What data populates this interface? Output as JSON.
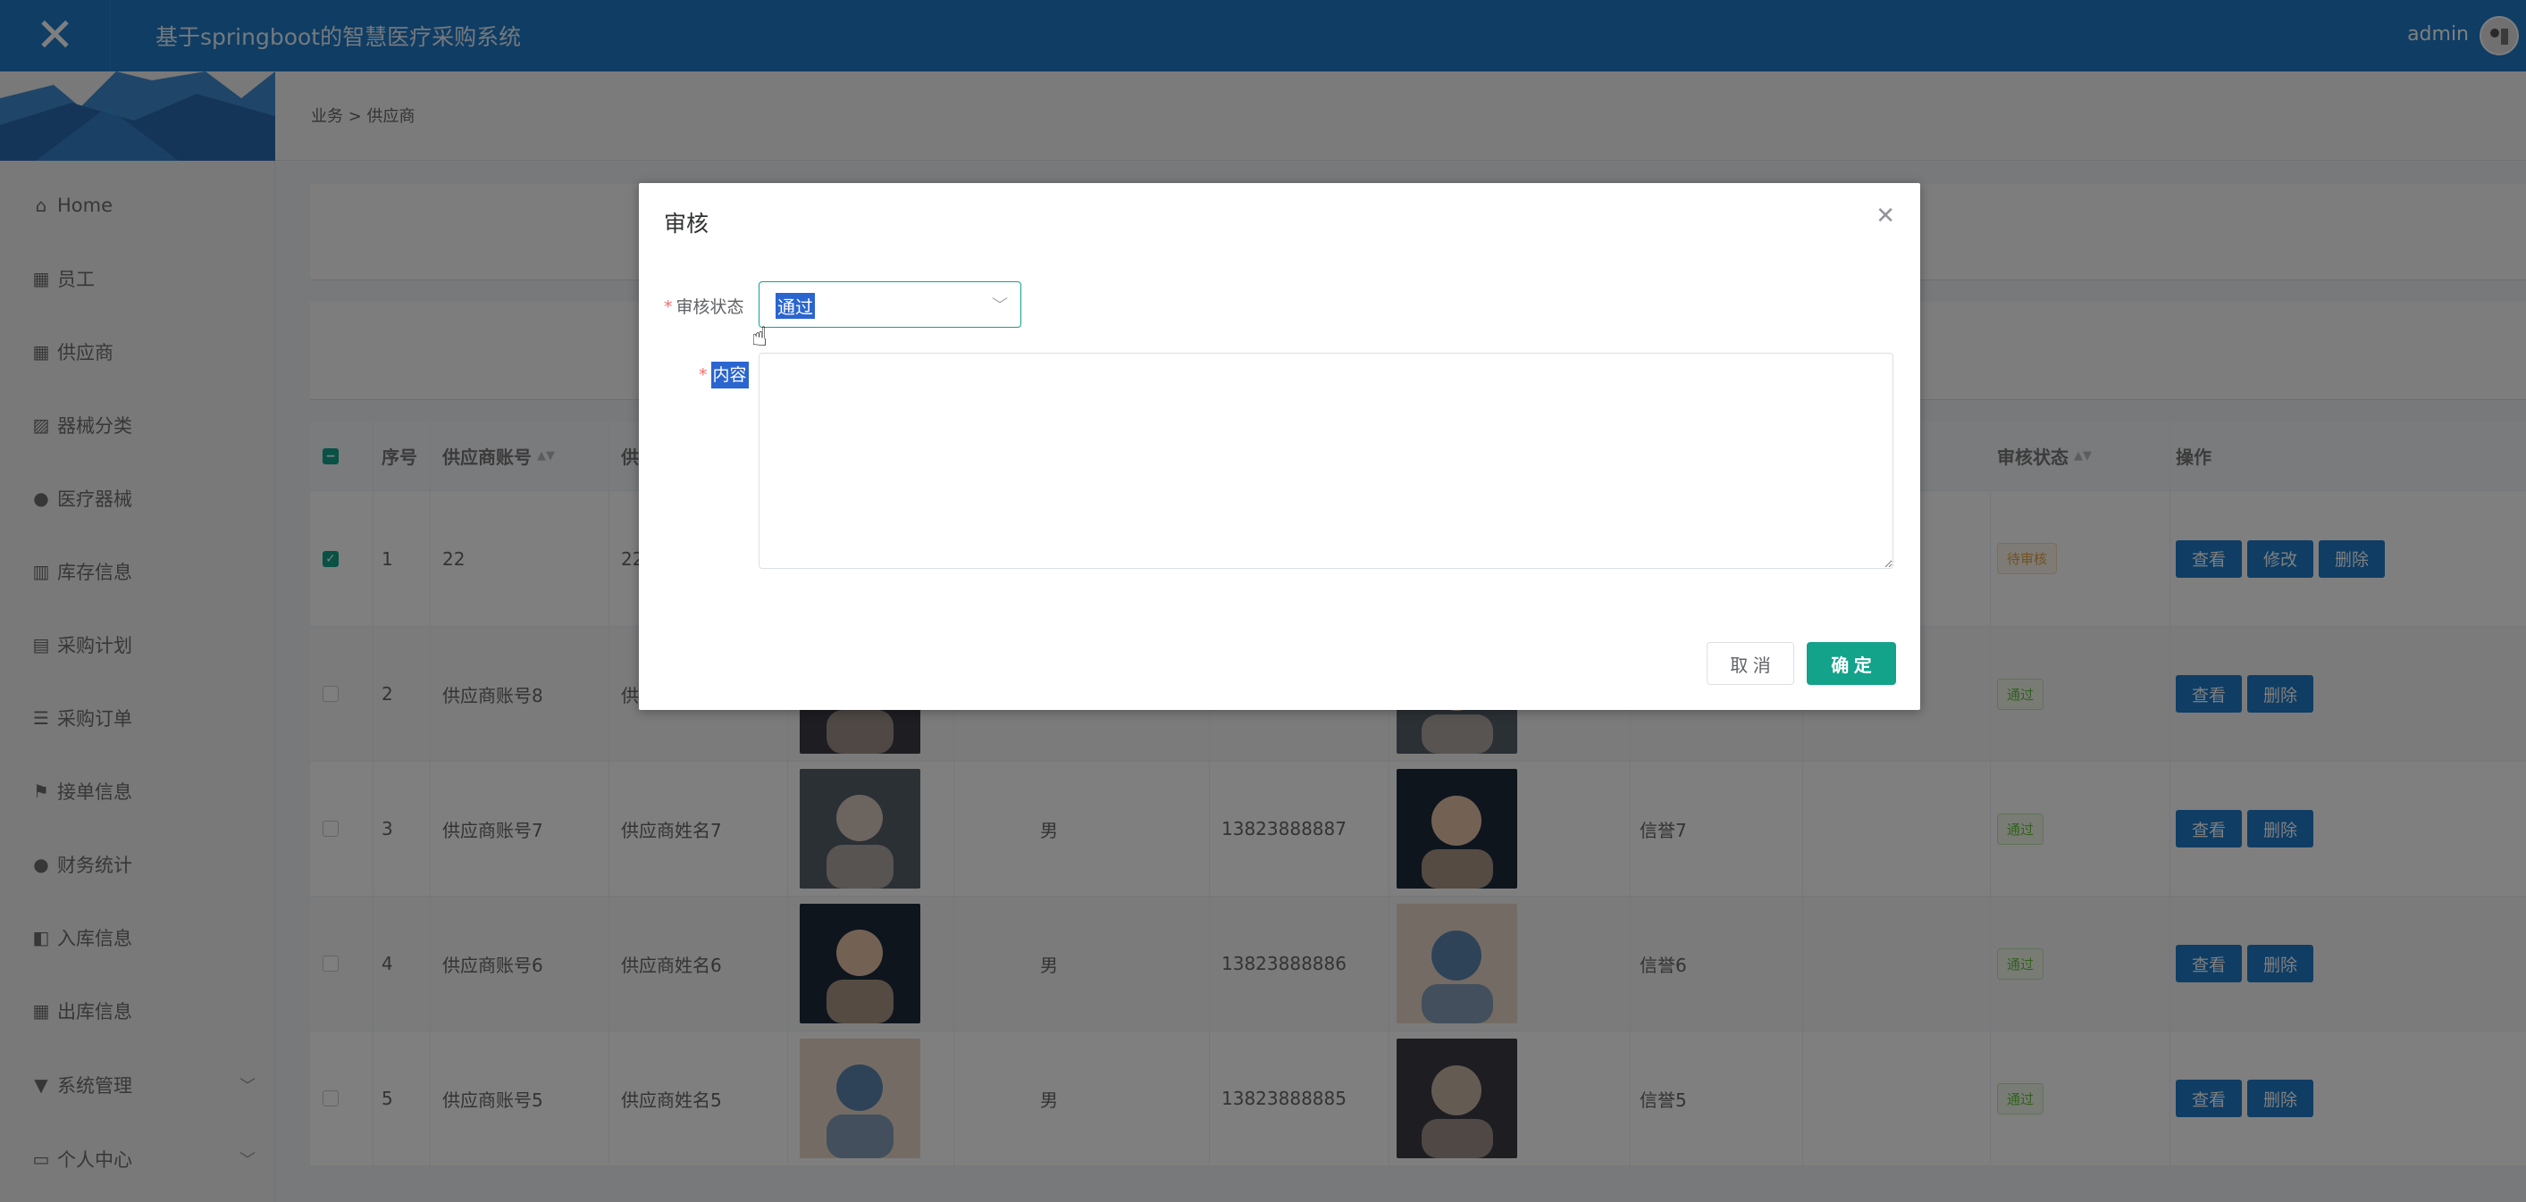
{
  "header": {
    "title": "基于springboot的智慧医疗采购系统",
    "user": "admin",
    "close_glyph": "✕"
  },
  "sidebar": {
    "items": [
      {
        "label": "Home",
        "icon": "home-icon"
      },
      {
        "label": "员工",
        "icon": "grid-icon"
      },
      {
        "label": "供应商",
        "icon": "grid-icon"
      },
      {
        "label": "器械分类",
        "icon": "chart-icon"
      },
      {
        "label": "医疗器械",
        "icon": "user-icon"
      },
      {
        "label": "库存信息",
        "icon": "library-icon"
      },
      {
        "label": "采购计划",
        "icon": "clipboard-icon"
      },
      {
        "label": "采购订单",
        "icon": "list-icon"
      },
      {
        "label": "接单信息",
        "icon": "flag-icon"
      },
      {
        "label": "财务统计",
        "icon": "user-icon"
      },
      {
        "label": "入库信息",
        "icon": "ticket-icon"
      },
      {
        "label": "出库信息",
        "icon": "grid-icon"
      },
      {
        "label": "系统管理",
        "icon": "settings-icon"
      },
      {
        "label": "个人中心",
        "icon": "window-icon"
      }
    ]
  },
  "breadcrumb": "业务 > 供应商",
  "table": {
    "headers": {
      "index": "序号",
      "account": "供应商账号",
      "name_partial": "供",
      "status": "审核状态",
      "actions": "操作"
    },
    "rows": [
      {
        "index": "1",
        "account": "22",
        "name": "22",
        "gender": "",
        "phone": "",
        "credit": "",
        "status": "待审核",
        "status_color": "#e6a23c",
        "buttons": [
          "查看",
          "修改",
          "删除"
        ],
        "checked": true,
        "photos": false
      },
      {
        "index": "2",
        "account": "供应商账号8",
        "name": "供",
        "gender": "",
        "phone": "",
        "credit": "",
        "status": "通过",
        "status_color": "#67c23a",
        "buttons": [
          "查看",
          "删除"
        ],
        "checked": false,
        "photos": true
      },
      {
        "index": "3",
        "account": "供应商账号7",
        "name": "供应商姓名7",
        "gender": "男",
        "phone": "13823888887",
        "credit": "信誉7",
        "status": "通过",
        "status_color": "#67c23a",
        "buttons": [
          "查看",
          "删除"
        ],
        "checked": false,
        "photos": true
      },
      {
        "index": "4",
        "account": "供应商账号6",
        "name": "供应商姓名6",
        "gender": "男",
        "phone": "13823888886",
        "credit": "信誉6",
        "status": "通过",
        "status_color": "#67c23a",
        "buttons": [
          "查看",
          "删除"
        ],
        "checked": false,
        "photos": true
      },
      {
        "index": "5",
        "account": "供应商账号5",
        "name": "供应商姓名5",
        "gender": "男",
        "phone": "13823888885",
        "credit": "信誉5",
        "status": "通过",
        "status_color": "#67c23a",
        "buttons": [
          "查看",
          "删除"
        ],
        "checked": false,
        "photos": true
      }
    ]
  },
  "dialog": {
    "title": "审核",
    "status_label": "审核状态",
    "status_value": "通过",
    "content_label": "内容",
    "content_value": "",
    "cancel_label": "取 消",
    "ok_label": "确 定"
  },
  "colors": {
    "primary": "#1e7ac9",
    "accent": "#13a28a"
  }
}
